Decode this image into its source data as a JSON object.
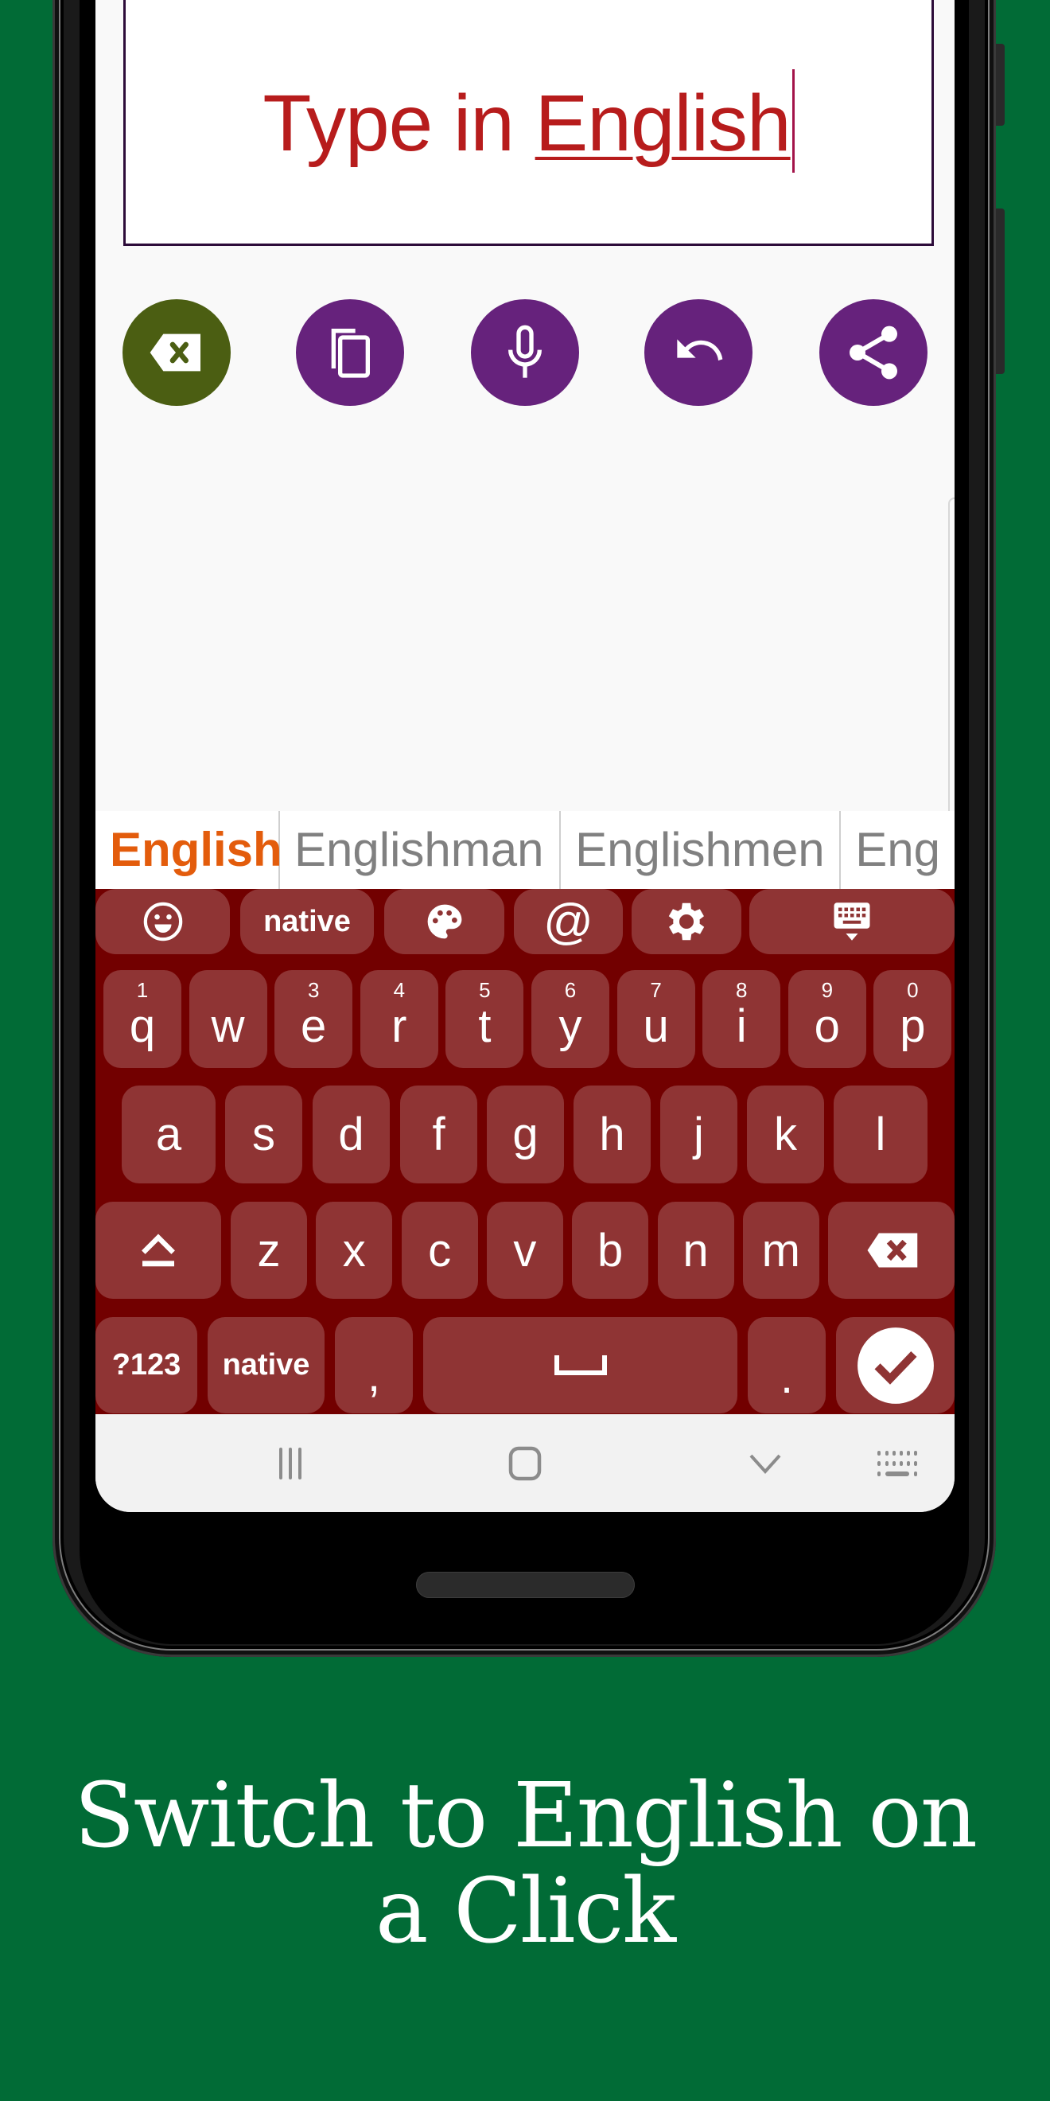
{
  "editor": {
    "text_plain": "Type in ",
    "text_composing": "English"
  },
  "actions": [
    {
      "name": "clear-button",
      "icon": "backspace-icon",
      "color": "#4b5e12"
    },
    {
      "name": "copy-button",
      "icon": "copy-icon",
      "color": "#66227c"
    },
    {
      "name": "voice-input-button",
      "icon": "microphone-icon",
      "color": "#66227c"
    },
    {
      "name": "undo-button",
      "icon": "undo-icon",
      "color": "#66227c"
    },
    {
      "name": "share-button",
      "icon": "share-icon",
      "color": "#66227c"
    }
  ],
  "suggestions": [
    "English",
    "Englishman",
    "Englishmen",
    "Eng"
  ],
  "toolbar": {
    "emoji_icon": "emoji-icon",
    "native_label": "native",
    "theme_icon": "palette-icon",
    "at_label": "@",
    "settings_icon": "gear-icon",
    "hide_icon": "keyboard-hide-icon"
  },
  "keyboard": {
    "row1": [
      {
        "key": "q",
        "hint": "1"
      },
      {
        "key": "w",
        "hint": ""
      },
      {
        "key": "e",
        "hint": "3"
      },
      {
        "key": "r",
        "hint": "4"
      },
      {
        "key": "t",
        "hint": "5"
      },
      {
        "key": "y",
        "hint": "6"
      },
      {
        "key": "u",
        "hint": "7"
      },
      {
        "key": "i",
        "hint": "8"
      },
      {
        "key": "o",
        "hint": "9"
      },
      {
        "key": "p",
        "hint": "0"
      }
    ],
    "row2": [
      "a",
      "s",
      "d",
      "f",
      "g",
      "h",
      "j",
      "k",
      "l"
    ],
    "row3": [
      "z",
      "x",
      "c",
      "v",
      "b",
      "n",
      "m"
    ],
    "symbols_label": "?123",
    "native_label": "native",
    "comma": ",",
    "period": ".",
    "theme_color": "#720000",
    "key_color": "#8f3434"
  },
  "caption": {
    "line1": "Switch to English on",
    "line2": "a Click"
  }
}
